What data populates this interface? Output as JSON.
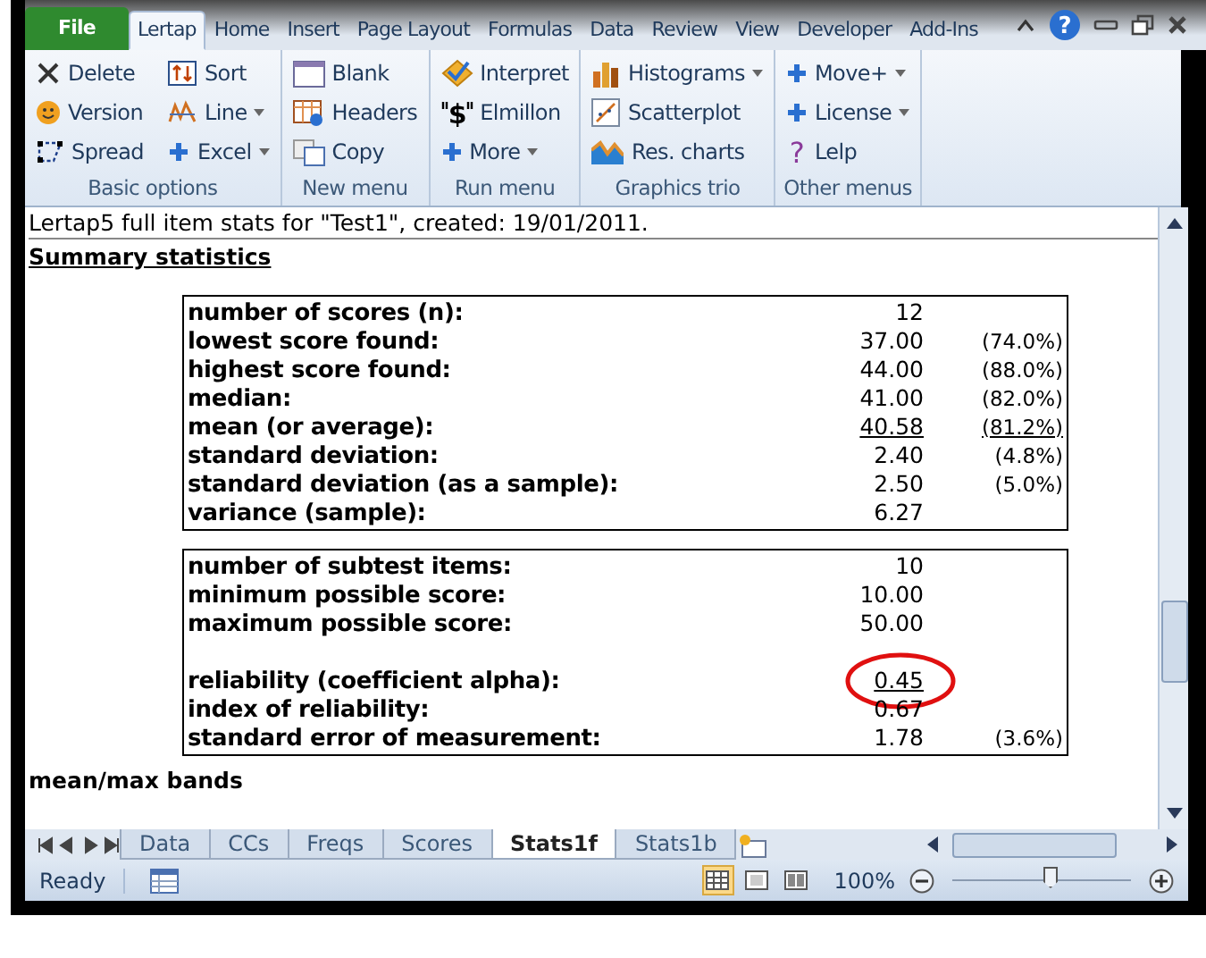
{
  "help_button": {
    "glyph": "?"
  },
  "ribbon_tabs": [
    {
      "label": "File",
      "kind": "file",
      "selected": false
    },
    {
      "label": "Lertap",
      "kind": "tab",
      "selected": true
    },
    {
      "label": "Home",
      "kind": "tab",
      "selected": false
    },
    {
      "label": "Insert",
      "kind": "tab",
      "selected": false
    },
    {
      "label": "Page Layout",
      "kind": "tab",
      "selected": false
    },
    {
      "label": "Formulas",
      "kind": "tab",
      "selected": false
    },
    {
      "label": "Data",
      "kind": "tab",
      "selected": false
    },
    {
      "label": "Review",
      "kind": "tab",
      "selected": false
    },
    {
      "label": "View",
      "kind": "tab",
      "selected": false
    },
    {
      "label": "Developer",
      "kind": "tab",
      "selected": false
    },
    {
      "label": "Add-Ins",
      "kind": "tab",
      "selected": false
    }
  ],
  "ribbon_groups": [
    {
      "label": "Basic options",
      "buttons": [
        {
          "label": "Delete",
          "kind": "cross",
          "dropdown": false
        },
        {
          "label": "Version",
          "kind": "smiley",
          "dropdown": false
        },
        {
          "label": "Spread",
          "kind": "spread",
          "dropdown": false
        },
        {
          "label": "Sort",
          "kind": "sort",
          "dropdown": false
        },
        {
          "label": "Line",
          "kind": "line",
          "dropdown": true
        },
        {
          "label": "Excel",
          "kind": "plus",
          "dropdown": true
        }
      ]
    },
    {
      "label": "New menu",
      "buttons": [
        {
          "label": "Blank",
          "kind": "window",
          "dropdown": false
        },
        {
          "label": "Headers",
          "kind": "grid",
          "dropdown": false
        },
        {
          "label": "Copy",
          "kind": "copy",
          "dropdown": false
        }
      ]
    },
    {
      "label": "Run menu",
      "buttons": [
        {
          "label": "Interpret",
          "kind": "diamond",
          "dropdown": false
        },
        {
          "label": "Elmillon",
          "kind": "dollar",
          "glyph": "$",
          "dropdown": false
        },
        {
          "label": "More",
          "kind": "plus",
          "dropdown": true
        }
      ]
    },
    {
      "label": "Graphics trio",
      "buttons": [
        {
          "label": "Histograms",
          "kind": "bars",
          "dropdown": true
        },
        {
          "label": "Scatterplot",
          "kind": "scatter",
          "dropdown": false
        },
        {
          "label": "Res. charts",
          "kind": "area",
          "dropdown": false
        }
      ]
    },
    {
      "label": "Other menus",
      "buttons": [
        {
          "label": "Move+",
          "kind": "plus",
          "dropdown": true
        },
        {
          "label": "License",
          "kind": "plus",
          "dropdown": true
        },
        {
          "label": "Lelp",
          "kind": "question",
          "glyph": "?",
          "dropdown": false
        }
      ]
    }
  ],
  "sheet": {
    "title_line": "Lertap5 full item stats for \"Test1\", created: 19/01/2011.",
    "heading": "Summary statistics",
    "tables": [
      {
        "rows": [
          {
            "kind": "stat",
            "label": "number of scores (n):",
            "value": "12",
            "underlined": false
          },
          {
            "kind": "stat",
            "label": "lowest score found:",
            "value": "37.00",
            "percent": "(74.0%)",
            "underlined": false
          },
          {
            "kind": "stat",
            "label": "highest score found:",
            "value": "44.00",
            "percent": "(88.0%)",
            "underlined": false
          },
          {
            "kind": "stat",
            "label": "median:",
            "value": "41.00",
            "percent": "(82.0%)",
            "underlined": false
          },
          {
            "kind": "stat",
            "label": "mean (or average):",
            "value": "40.58",
            "percent": "(81.2%)",
            "underlined": true
          },
          {
            "kind": "stat",
            "label": "standard deviation:",
            "value": "2.40",
            "percent": "(4.8%)",
            "underlined": false
          },
          {
            "kind": "stat",
            "label": "standard deviation (as a sample):",
            "value": "2.50",
            "percent": "(5.0%)",
            "underlined": false
          },
          {
            "kind": "stat",
            "label": "variance (sample):",
            "value": "6.27",
            "underlined": false
          }
        ]
      },
      {
        "rows": [
          {
            "kind": "stat",
            "label": "number of subtest items:",
            "value": "10",
            "underlined": false
          },
          {
            "kind": "stat",
            "label": "minimum possible score:",
            "value": "10.00",
            "underlined": false
          },
          {
            "kind": "stat",
            "label": "maximum possible score:",
            "value": "50.00",
            "underlined": false
          },
          {
            "kind": "spacer"
          },
          {
            "kind": "stat",
            "label": "reliability (coefficient alpha):",
            "value": "0.45",
            "underlined": true,
            "circled": true
          },
          {
            "kind": "stat",
            "label": "index of reliability:",
            "value": "0.67",
            "underlined": false
          },
          {
            "kind": "stat",
            "label": "standard error of measurement:",
            "value": "1.78",
            "percent": "(3.6%)",
            "underlined": false
          }
        ]
      }
    ],
    "footer_heading": "mean/max bands"
  },
  "sheet_tabs": [
    {
      "label": "Data",
      "selected": false
    },
    {
      "label": "CCs",
      "selected": false
    },
    {
      "label": "Freqs",
      "selected": false
    },
    {
      "label": "Scores",
      "selected": false
    },
    {
      "label": "Stats1f",
      "selected": true
    },
    {
      "label": "Stats1b",
      "selected": false
    }
  ],
  "status_bar": {
    "status": "Ready",
    "views": [
      {
        "kind": "normal",
        "selected": true
      },
      {
        "kind": "layout",
        "selected": false
      },
      {
        "kind": "pagebreak",
        "selected": false
      }
    ],
    "zoom": "100%",
    "zoom_slider": {
      "level": 0.55
    }
  }
}
